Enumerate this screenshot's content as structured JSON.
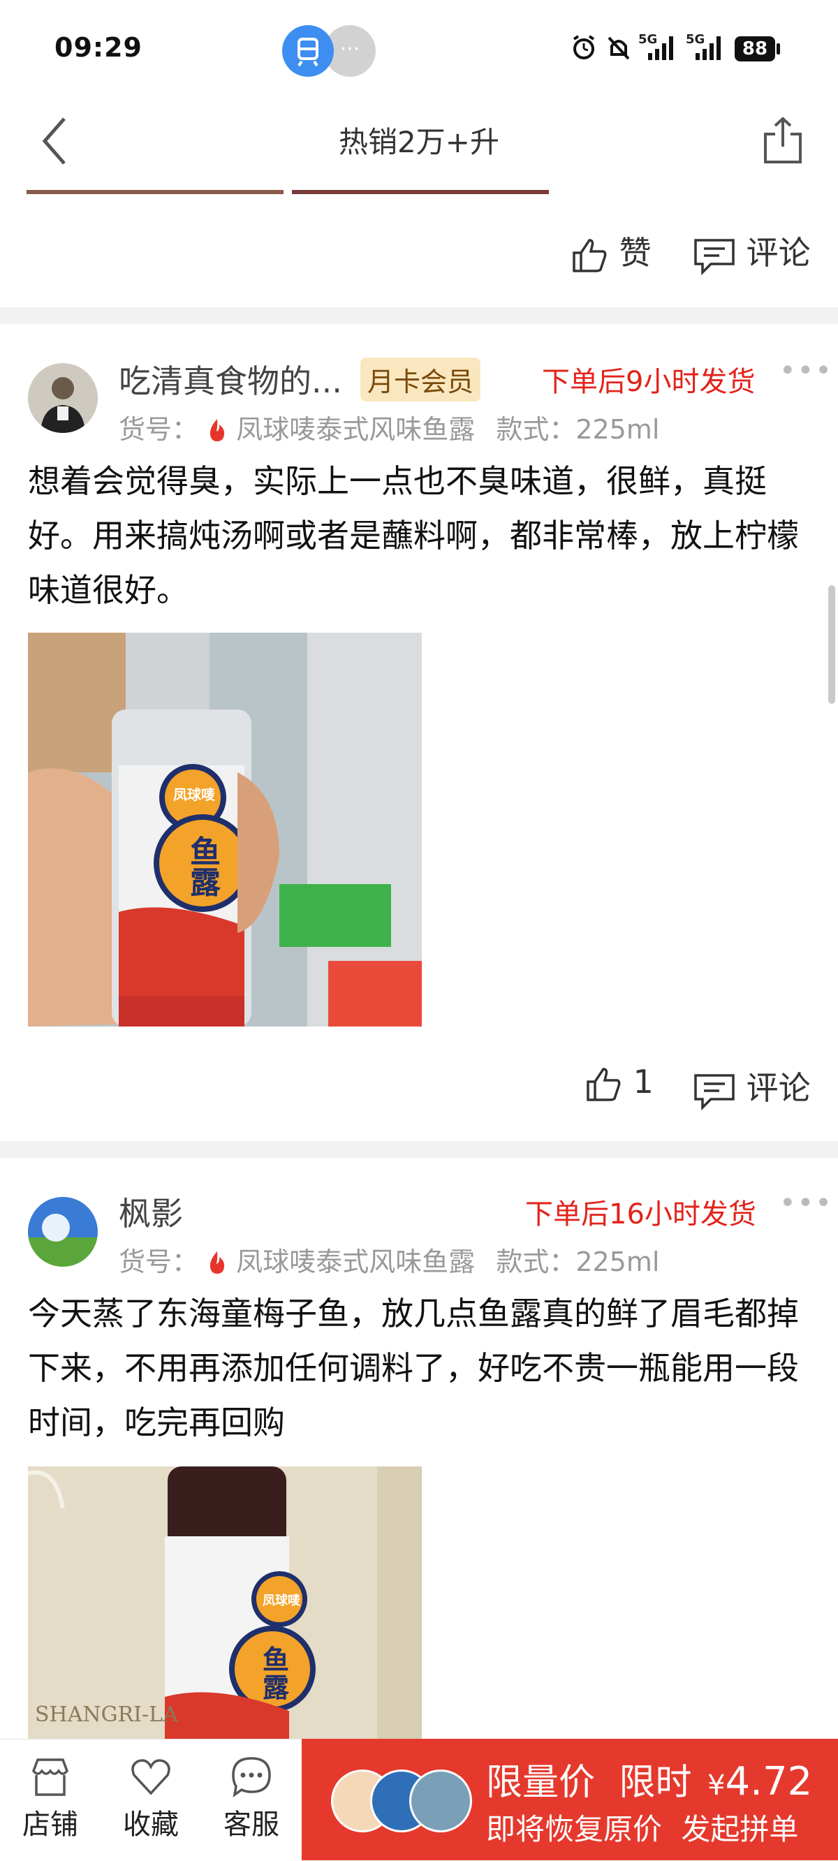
{
  "status_bar": {
    "time": "09:29",
    "network_1": "5G",
    "network_2": "5G",
    "battery": "88"
  },
  "nav": {
    "title": "热销2万+升"
  },
  "actions_top": {
    "like_label": "赞",
    "comment_label": "评论"
  },
  "reviews": [
    {
      "username": "吃清真食物的...",
      "badge": "月卡会员",
      "shipping": "下单后9小时发货",
      "product_label": "货号：",
      "product_name": "凤球唛泰式风味鱼露",
      "spec_label": "款式：",
      "spec_value": "225ml",
      "text": "想着会觉得臭，实际上一点也不臭味道，很鲜，真挺好。用来搞炖汤啊或者是蘸料啊，都非常棒，放上柠檬味道很好。",
      "like_count": "1",
      "comment_label": "评论",
      "photo_brand": "凤球唛",
      "photo_title_1": "鱼",
      "photo_title_2": "露"
    },
    {
      "username": "枫影",
      "shipping": "下单后16小时发货",
      "product_label": "货号：",
      "product_name": "凤球唛泰式风味鱼露",
      "spec_label": "款式：",
      "spec_value": "225ml",
      "text": "今天蒸了东海童梅子鱼，放几点鱼露真的鲜了眉毛都掉下来，不用再添加任何调料了，好吃不贵一瓶能用一段时间，吃完再回购",
      "photo_brand": "凤球唛",
      "photo_title_1": "鱼",
      "photo_title_2": "露",
      "photo_hotel": "SHANGRI-LA"
    }
  ],
  "bottom_bar": {
    "store": "店铺",
    "favorite": "收藏",
    "service": "客服",
    "promo_label": "限量价",
    "promo_time": "限时",
    "promo_currency": "¥",
    "promo_price": "4.72",
    "promo_sub": "即将恢复原价",
    "promo_action": "发起拼单"
  },
  "colors": {
    "accent_red": "#e5392d",
    "ship_red": "#e2231a",
    "badge_bg": "#fbe7bf"
  }
}
